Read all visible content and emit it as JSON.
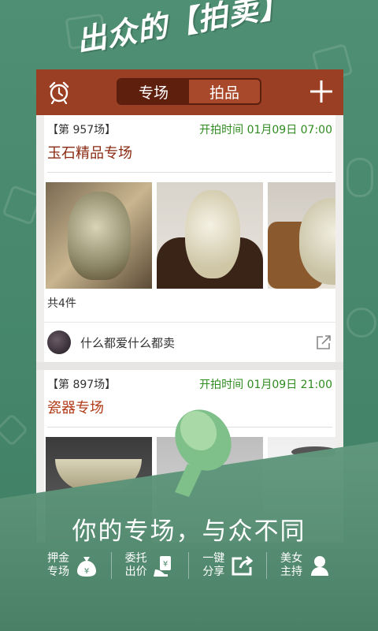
{
  "headline": "出众的【拍卖】",
  "topbar": {
    "tab_sessions": "专场",
    "tab_items": "拍品"
  },
  "sessions": [
    {
      "number": "【第 957场】",
      "start_time": "开拍时间 01月09日 07:00",
      "title": "玉石精品专场",
      "count": "共4件",
      "seller": "什么都爱什么都卖"
    },
    {
      "number": "【第 897场】",
      "start_time": "开拍时间 01月09日 21:00",
      "title": "瓷器专场"
    }
  ],
  "tagline": "你的专场，与众不同",
  "features": [
    {
      "line1": "押金",
      "line2": "专场",
      "icon": "money-bag-icon"
    },
    {
      "line1": "委托",
      "line2": "出价",
      "icon": "hand-money-icon"
    },
    {
      "line1": "一键",
      "line2": "分享",
      "icon": "share-icon"
    },
    {
      "line1": "美女",
      "line2": "主持",
      "icon": "host-icon"
    }
  ],
  "colors": {
    "background": "#4a8a6e",
    "topbar": "#9b3f24",
    "title": "#8b2a12",
    "time": "#2e8b1e"
  }
}
